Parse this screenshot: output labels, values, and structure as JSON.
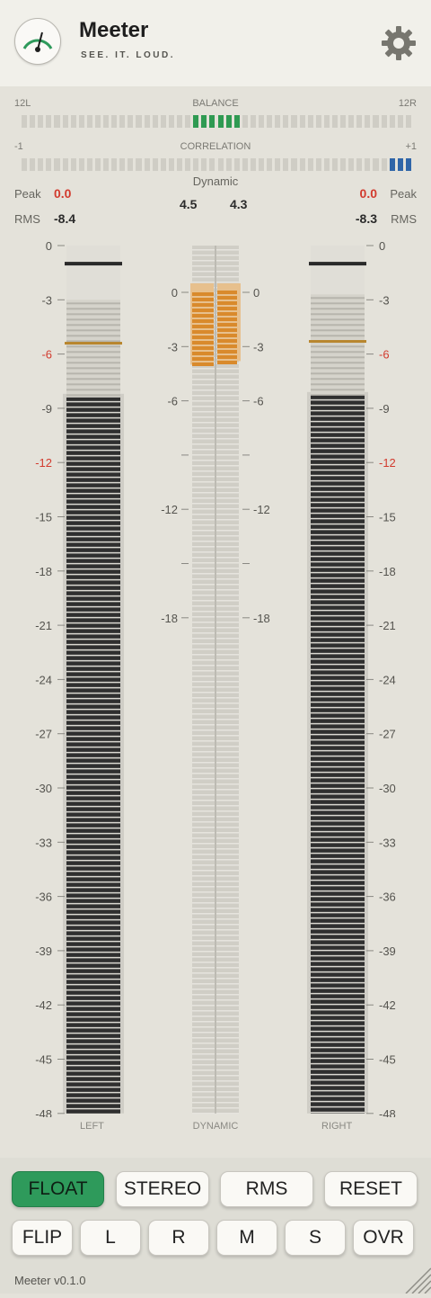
{
  "app": {
    "title": "Meeter",
    "tagline": "SEE. IT. LOUD.",
    "version": "Meeter v0.1.0",
    "logo_icon": "meter-gauge-icon",
    "settings_icon": "gear-icon"
  },
  "balance": {
    "label": "BALANCE",
    "left_label": "12L",
    "right_label": "12R",
    "lit_from_center": 3
  },
  "correlation": {
    "label": "CORRELATION",
    "left_label": "-1",
    "right_label": "+1",
    "lit_from_right": 3
  },
  "stats": {
    "left_peak_label": "Peak",
    "left_peak": "0.0",
    "left_rms_label": "RMS",
    "left_rms": "-8.4",
    "right_peak_label": "Peak",
    "right_peak": "0.0",
    "right_rms_label": "RMS",
    "right_rms": "-8.3",
    "dynamic_label": "Dynamic",
    "dynamic_left": "4.5",
    "dynamic_right": "4.3"
  },
  "meters": {
    "scale_ticks": [
      "0",
      "-3",
      "-6",
      "-9",
      "-12",
      "-15",
      "-18",
      "-21",
      "-24",
      "-27",
      "-30",
      "-33",
      "-36",
      "-39",
      "-42",
      "-45",
      "-48"
    ],
    "red_ticks": [
      "-6",
      "-12"
    ],
    "dynamic_ticks": [
      "0",
      "-3",
      "-6",
      "",
      "-12",
      "",
      "-18"
    ],
    "left": {
      "label": "LEFT",
      "peak_db": -1,
      "rms_db": -8.4,
      "target_db": -5.4,
      "headroom_db": -3
    },
    "right": {
      "label": "RIGHT",
      "peak_db": -1,
      "rms_db": -8.3,
      "target_db": -5.3,
      "headroom_db": -2.7
    },
    "dynamic": {
      "label": "DYNAMIC",
      "left_db": 4.5,
      "right_db": 4.3
    }
  },
  "colors": {
    "accent_green": "#2e9a5b",
    "balance_lit": "#2f9a52",
    "correlation_lit": "#2f65a8",
    "peak_red": "#d23b2e",
    "meter_dark": "#2f2f2f",
    "dynamic_orange": "#d98a2c",
    "target_line": "#b8862e"
  },
  "buttons": {
    "row1": [
      "FLOAT",
      "STEREO",
      "RMS",
      "RESET"
    ],
    "row2": [
      "FLIP",
      "L",
      "R",
      "M",
      "S",
      "OVR"
    ],
    "active": "FLOAT"
  }
}
